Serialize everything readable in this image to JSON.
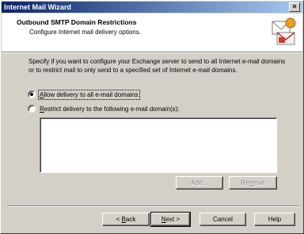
{
  "window": {
    "title": "Internet Mail Wizard",
    "close_glyph": "×"
  },
  "header": {
    "title": "Outbound SMTP Domain Restrictions",
    "subtitle": "Configure Internet mail delivery options."
  },
  "description": "Specify if you want to configure your Exchange server to send to all Internet e-mail domains or to restrict mail to only send to a specified set of Internet e-mail domains.",
  "options": {
    "allow_all": {
      "mnemonic": "A",
      "rest": "llow delivery to all e-mail domains",
      "checked": true
    },
    "restrict": {
      "mnemonic": "R",
      "rest": "estrict delivery to the following e-mail domain(s):",
      "checked": false
    }
  },
  "domain_list": [],
  "list_buttons": {
    "add": "Add...",
    "remove_pre": "Re",
    "remove_mnemonic": "m",
    "remove_post": "ove"
  },
  "footer": {
    "back_pre": "< ",
    "back_mnemonic": "B",
    "back_post": "ack",
    "next_mnemonic": "N",
    "next_post": "ext >",
    "cancel": "Cancel",
    "help": "Help"
  },
  "colors": {
    "titlebar_start": "#0a246a",
    "titlebar_end": "#a6caf0",
    "face": "#d4d0c8"
  }
}
